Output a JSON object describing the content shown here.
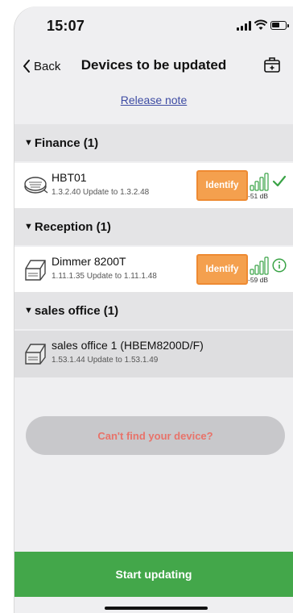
{
  "status_bar": {
    "time": "15:07"
  },
  "nav": {
    "back_label": "Back",
    "title": "Devices to be updated",
    "action_icon": "export-box-icon"
  },
  "release_note": "Release note",
  "groups": [
    {
      "header": "Finance (1)",
      "device": {
        "name": "HBT01",
        "version": "1.3.2.40 Update to 1.3.2.48",
        "identify_label": "Identify",
        "signal": "-51 dB",
        "status_icon": "checkmark-icon",
        "status_color": "#3aa346"
      }
    },
    {
      "header": "Reception (1)",
      "device": {
        "name": "Dimmer 8200T",
        "version": "1.11.1.35 Update to 1.11.1.48",
        "identify_label": "Identify",
        "signal": "-59 dB",
        "status_icon": "info-icon",
        "status_color": "#3aa346"
      }
    },
    {
      "header": "sales office (1)",
      "device": {
        "name": "sales office 1 (HBEM8200D/F)",
        "version": "1.53.1.44 Update to 1.53.1.49"
      }
    }
  ],
  "cant_find_label": "Can't find your device?",
  "start_label": "Start updating",
  "colors": {
    "accent_green": "#43a74a",
    "identify_orange": "#f4a04e",
    "link_blue": "#3d4ba3",
    "warning_red": "#e8736a"
  }
}
